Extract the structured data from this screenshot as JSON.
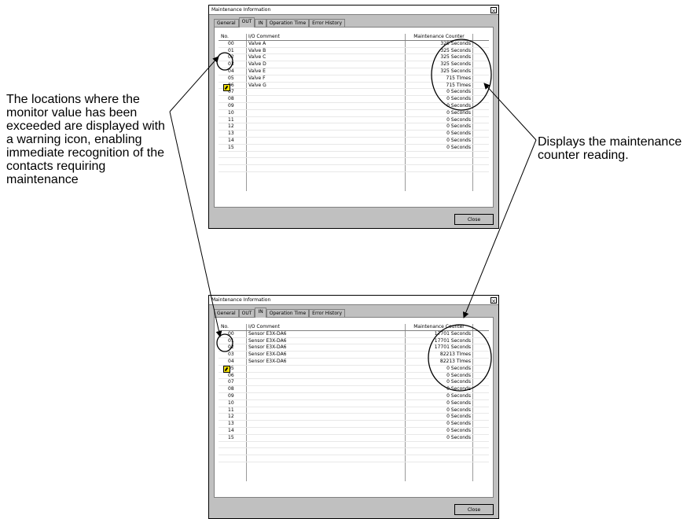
{
  "callouts": {
    "left": "The locations where the monitor value has been exceeded are displayed with a warning icon, enabling immediate recognition of the contacts requiring maintenance",
    "right": "Displays the maintenance counter reading."
  },
  "windows": [
    {
      "title": "Maintenance Information",
      "tabs": [
        "General",
        "OUT",
        "IN",
        "Operation Time",
        "Error History"
      ],
      "active_tab": "OUT",
      "columns": [
        "No.",
        "I/O Comment",
        "Maintenance Counter"
      ],
      "rows": [
        {
          "no": "00",
          "comment": "Valve A",
          "counter": "325 Seconds"
        },
        {
          "no": "01",
          "comment": "Valve B",
          "counter": "325 Seconds"
        },
        {
          "no": "02",
          "comment": "Valve C",
          "counter": "325 Seconds"
        },
        {
          "no": "03",
          "comment": "Valve D",
          "counter": "325 Seconds"
        },
        {
          "no": "04",
          "comment": "Valve E",
          "counter": "325 Seconds"
        },
        {
          "no": "05",
          "comment": "Valve F",
          "counter": "715 TImes"
        },
        {
          "no": "06",
          "comment": "Valve G",
          "counter": "715 TImes"
        },
        {
          "no": "07",
          "comment": "",
          "counter": "0 Seconds"
        },
        {
          "no": "08",
          "comment": "",
          "counter": "0 Seconds"
        },
        {
          "no": "09",
          "comment": "",
          "counter": "0 Seconds"
        },
        {
          "no": "10",
          "comment": "",
          "counter": "0 Seconds"
        },
        {
          "no": "11",
          "comment": "",
          "counter": "0 Seconds"
        },
        {
          "no": "12",
          "comment": "",
          "counter": "0 Seconds"
        },
        {
          "no": "13",
          "comment": "",
          "counter": "0 Seconds"
        },
        {
          "no": "14",
          "comment": "",
          "counter": "0 Seconds"
        },
        {
          "no": "15",
          "comment": "",
          "counter": "0 Seconds"
        }
      ],
      "close_label": "Close"
    },
    {
      "title": "Maintenance Information",
      "tabs": [
        "General",
        "OUT",
        "IN",
        "Operation Time",
        "Error History"
      ],
      "active_tab": "IN",
      "columns": [
        "No.",
        "I/O Comment",
        "Maintenance Counter"
      ],
      "rows": [
        {
          "no": "00",
          "comment": "Sensor E3X-DA6",
          "counter": "17701 Seconds"
        },
        {
          "no": "01",
          "comment": "Sensor E3X-DA6",
          "counter": "17701 Seconds"
        },
        {
          "no": "02",
          "comment": "Sensor E3X-DA6",
          "counter": "17701 Seconds"
        },
        {
          "no": "03",
          "comment": "Sensor E3X-DA6",
          "counter": "82213 TImes"
        },
        {
          "no": "04",
          "comment": "Sensor E3X-DA6",
          "counter": "82213 TImes"
        },
        {
          "no": "05",
          "comment": "",
          "counter": "0 Seconds"
        },
        {
          "no": "06",
          "comment": "",
          "counter": "0 Seconds"
        },
        {
          "no": "07",
          "comment": "",
          "counter": "0 Seconds"
        },
        {
          "no": "08",
          "comment": "",
          "counter": "0 Seconds"
        },
        {
          "no": "09",
          "comment": "",
          "counter": "0 Seconds"
        },
        {
          "no": "10",
          "comment": "",
          "counter": "0 Seconds"
        },
        {
          "no": "11",
          "comment": "",
          "counter": "0 Seconds"
        },
        {
          "no": "12",
          "comment": "",
          "counter": "0 Seconds"
        },
        {
          "no": "13",
          "comment": "",
          "counter": "0 Seconds"
        },
        {
          "no": "14",
          "comment": "",
          "counter": "0 Seconds"
        },
        {
          "no": "15",
          "comment": "",
          "counter": "0 Seconds"
        }
      ],
      "close_label": "Close"
    }
  ],
  "icons": {
    "warning": "warning-icon",
    "close": "close-icon"
  },
  "colors": {
    "warning_icon": "#f2e000",
    "window_bg": "#c0c0c0"
  }
}
